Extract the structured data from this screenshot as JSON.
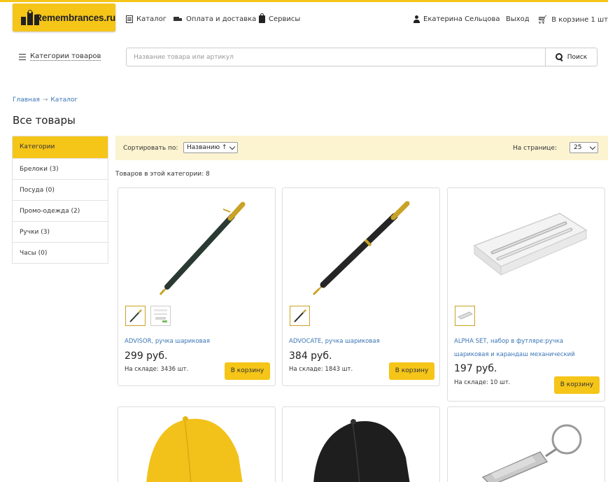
{
  "brand": {
    "name": "Remembrances.ru",
    "accent": "#f5c518",
    "link_color": "#3a75b5"
  },
  "topnav": {
    "catalog": "Каталог",
    "delivery": "Оплата и доставка",
    "services": "Сервисы",
    "user_name": "Екатерина Сельцова",
    "logout": "Выход",
    "cart": "В корзине 1 шт."
  },
  "categories_toggle": "Категории товаров",
  "search": {
    "placeholder": "Название товара или артикул",
    "value": "",
    "button": "Поиск"
  },
  "breadcrumb": {
    "home": "Главная",
    "separator": "→",
    "current": "Каталог"
  },
  "page_title": "Все товары",
  "sidebar": {
    "header": "Категории",
    "items": [
      {
        "label": "Брелоки (3)"
      },
      {
        "label": "Посуда (0)"
      },
      {
        "label": "Промо-одежда (2)"
      },
      {
        "label": "Ручки (3)"
      },
      {
        "label": "Часы (0)"
      }
    ]
  },
  "sort": {
    "label": "Сортировать по:",
    "selected": "Названию ↑",
    "per_page_label": "На странице:",
    "per_page": "25"
  },
  "category_count": "Товаров в этой категории: 8",
  "products": [
    {
      "name": "ADVISOR, ручка шариковая",
      "price": "299 руб.",
      "stock": "На складе: 3436 шт.",
      "button": "В корзину",
      "image": "black-pen-gold-trim"
    },
    {
      "name": "ADVOCATE, ручка шариковая",
      "price": "384 руб.",
      "stock": "На складе: 1843 шт.",
      "button": "В корзину",
      "image": "black-pen-gold-trim"
    },
    {
      "name_line1": "ALPHA SET, набор в футляре:ручка",
      "name_line2": "шариковая и карандаш механический",
      "price": "197 руб.",
      "stock": "На складе: 10 шт.",
      "button": "В корзину",
      "image": "silver-pen-set-case"
    },
    {
      "image": "yellow-cap"
    },
    {
      "image": "black-cap"
    },
    {
      "image": "silver-keychain"
    }
  ]
}
